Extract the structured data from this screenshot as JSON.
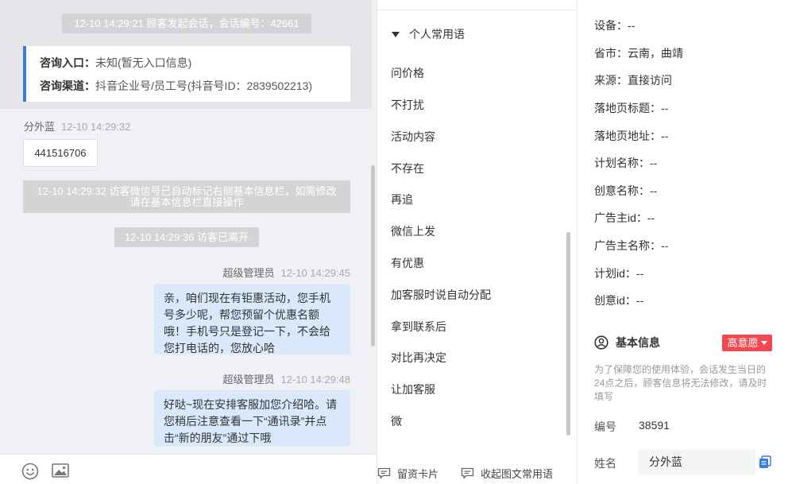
{
  "chat": {
    "sys1": "12-10 14:29:21 顾客发起会话，会话编号：42661",
    "info": {
      "entry_key": "咨询入口：",
      "entry_val": "未知(暂无入口信息)",
      "channel_key": "咨询渠道：",
      "channel_val": "抖音企业号/员工号(抖音号ID：2839502213)"
    },
    "visitor_name": "分外蓝",
    "visitor_time": "12-10 14:29:32",
    "visitor_msg": "441516706",
    "sys2": "12-10 14:29:32 访客微信号已自动标记右侧基本信息栏，如需修改请在基本信息栏直接操作",
    "sys3": "12-10 14:29:36 访客已离开",
    "agent1_name": "超级管理员",
    "agent1_time": "12-10 14:29:45",
    "agent1_msg": "亲，咱们现在有钜惠活动，您手机号多少呢，帮您预留个优惠名额哦！手机号只是登记一下，不会给您打电话的，您放心哈",
    "agent2_name": "超级管理员",
    "agent2_time": "12-10 14:29:48",
    "agent2_msg": "好哒~现在安排客服加您介绍哈。请您稍后注意查看一下“通讯录”并点击“新的朋友”通过下哦",
    "toolbar": {
      "emoji_icon": "smile-icon",
      "image_icon": "image-icon",
      "card_label": "留资卡片",
      "collapse_label": "收起图文常用语"
    }
  },
  "phrases": {
    "group_label": "个人常用语",
    "items": [
      "问价格",
      "不打扰",
      "活动内容",
      "不存在",
      "再追",
      "微信上发",
      "有优惠",
      "加客服时说自动分配",
      "拿到联系后",
      "对比再决定",
      "让加客服",
      "微"
    ]
  },
  "side": {
    "fields": [
      "设备：--",
      "省市：云南，曲靖",
      "来源：直接访问",
      "落地页标题：--",
      "落地页地址：--",
      "计划名称：--",
      "创意名称：--",
      "广告主id：--",
      "广告主名称：--",
      "计划id：--",
      "创意id：--"
    ],
    "section_title": "基本信息",
    "badge_label": "高意愿",
    "note": "为了保障您的使用体验，会话发生当日的24点之后，顾客信息将无法修改，请及时填写",
    "id_key": "编号",
    "id_val": "38591",
    "name_key": "姓名",
    "name_val": "分外蓝"
  },
  "colors": {
    "accent": "#3a7bdf",
    "badge": "#f2484f",
    "bubble": "#d9e8fb"
  }
}
